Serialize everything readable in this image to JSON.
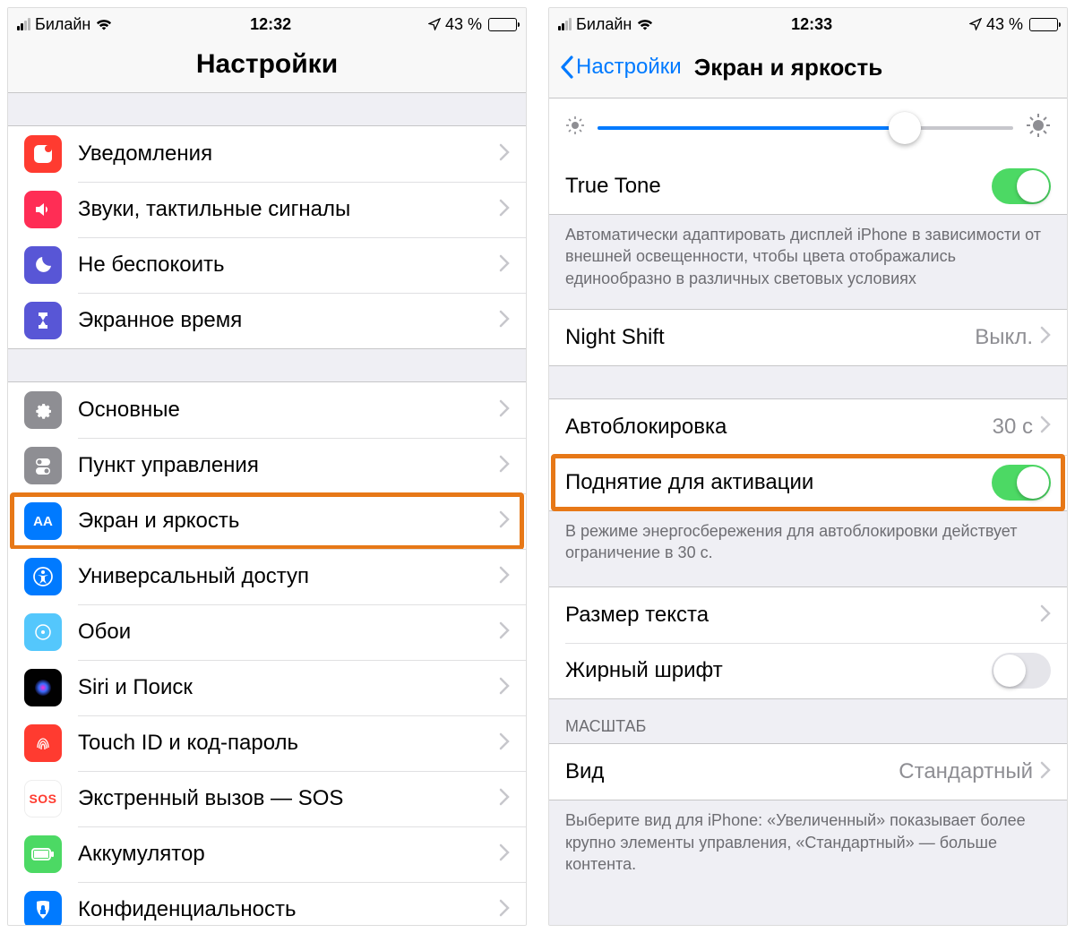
{
  "left": {
    "status": {
      "carrier": "Билайн",
      "time": "12:32",
      "battery_pct": "43 %",
      "battery_fill": 43
    },
    "title": "Настройки",
    "group1": [
      {
        "id": "notifications",
        "label": "Уведомления",
        "color": "red"
      },
      {
        "id": "sounds",
        "label": "Звуки, тактильные сигналы",
        "color": "red"
      },
      {
        "id": "dnd",
        "label": "Не беспокоить",
        "color": "purple"
      },
      {
        "id": "screentime",
        "label": "Экранное время",
        "color": "indigo"
      }
    ],
    "group2": [
      {
        "id": "general",
        "label": "Основные",
        "color": "gray"
      },
      {
        "id": "controlcenter",
        "label": "Пункт управления",
        "color": "graylight"
      },
      {
        "id": "display",
        "label": "Экран и яркость",
        "color": "blue",
        "highlight": true
      },
      {
        "id": "accessibility",
        "label": "Универсальный доступ",
        "color": "blue"
      },
      {
        "id": "wallpaper",
        "label": "Обои",
        "color": "cyan"
      },
      {
        "id": "siri",
        "label": "Siri и Поиск",
        "color": "black"
      },
      {
        "id": "touchid",
        "label": "Touch ID и код-пароль",
        "color": "red"
      },
      {
        "id": "sos",
        "label": "Экстренный вызов — SOS",
        "color": "red"
      },
      {
        "id": "battery",
        "label": "Аккумулятор",
        "color": "green"
      },
      {
        "id": "privacy",
        "label": "Конфиденциальность",
        "color": "blue"
      }
    ]
  },
  "right": {
    "status": {
      "carrier": "Билайн",
      "time": "12:33",
      "battery_pct": "43 %",
      "battery_fill": 43
    },
    "back": "Настройки",
    "title": "Экран и яркость",
    "brightness_pct": 74,
    "truetone": {
      "label": "True Tone",
      "on": true
    },
    "truetone_footer": "Автоматически адаптировать дисплей iPhone в зависимости от внешней освещенности, чтобы цвета отображались единообразно в различных световых условиях",
    "nightshift": {
      "label": "Night Shift",
      "value": "Выкл."
    },
    "autolock": {
      "label": "Автоблокировка",
      "value": "30 с"
    },
    "raisetowake": {
      "label": "Поднятие для активации",
      "on": true,
      "highlight": true
    },
    "autolock_footer": "В режиме энергосбережения для автоблокировки действует ограничение в 30 с.",
    "textsize": {
      "label": "Размер текста"
    },
    "bold": {
      "label": "Жирный шрифт",
      "on": false
    },
    "zoom_header": "МАСШТАБ",
    "zoom": {
      "label": "Вид",
      "value": "Стандартный"
    },
    "zoom_footer": "Выберите вид для iPhone: «Увеличенный» показывает более крупно элементы управления, «Стандартный» — больше контента."
  }
}
